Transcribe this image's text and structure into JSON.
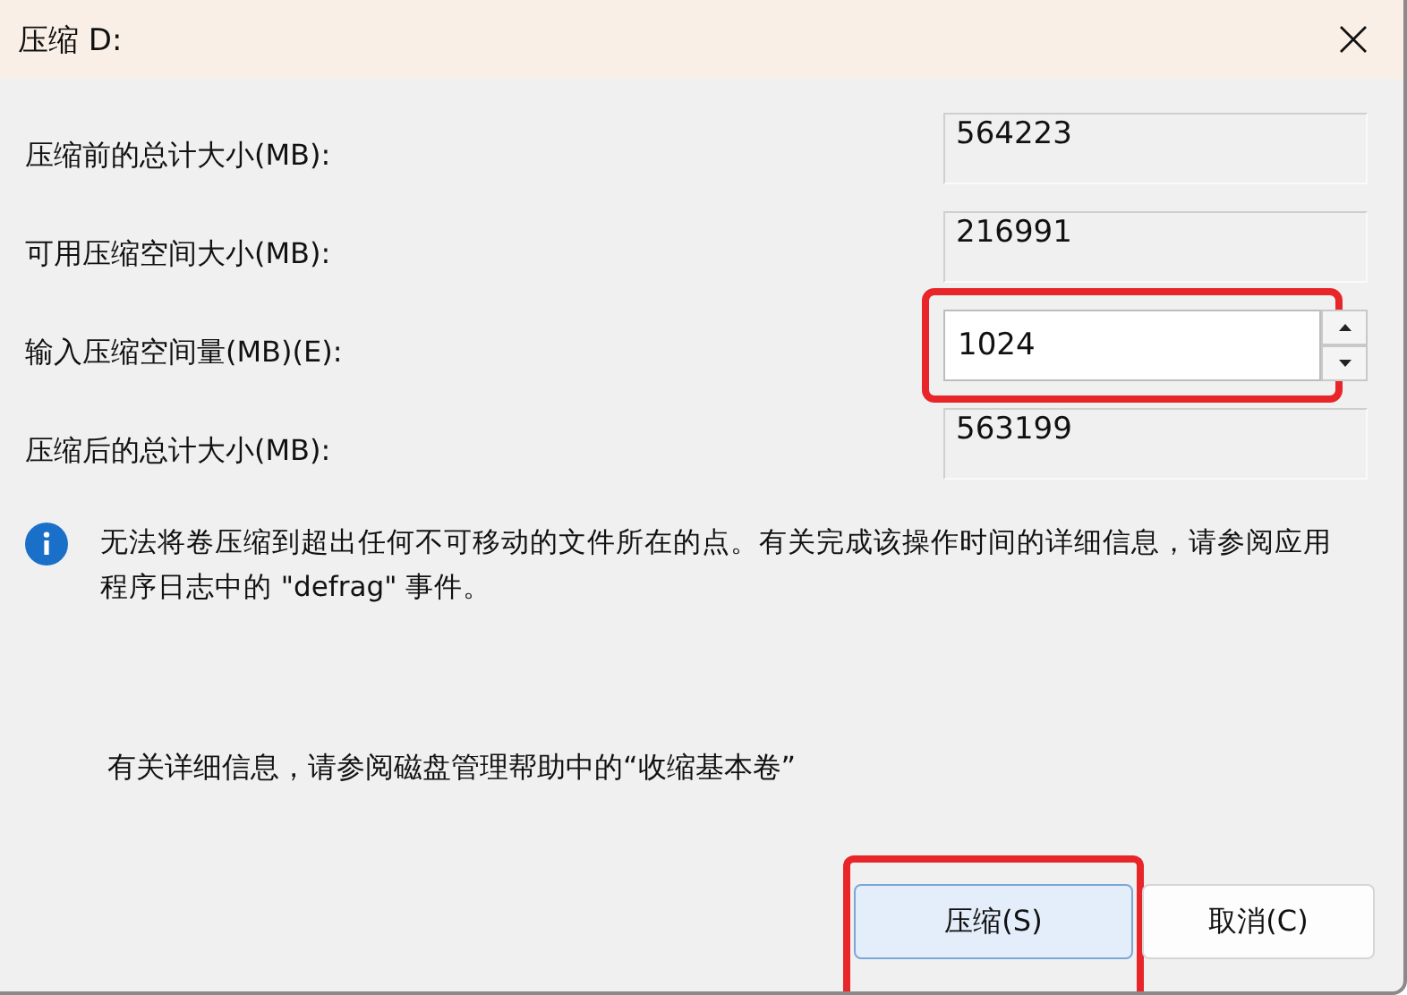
{
  "window": {
    "title": "压缩 D:"
  },
  "fields": [
    {
      "kind": "readonly",
      "label": "压缩前的总计大小(MB):",
      "value": "564223",
      "highlighted": false
    },
    {
      "kind": "readonly",
      "label": "可用压缩空间大小(MB):",
      "value": "216991",
      "highlighted": false
    },
    {
      "kind": "spin",
      "label": "输入压缩空间量(MB)(E):",
      "value": "1024",
      "highlighted": true
    },
    {
      "kind": "readonly",
      "label": "压缩后的总计大小(MB):",
      "value": "563199",
      "highlighted": false
    }
  ],
  "info": {
    "text": "无法将卷压缩到超出任何不可移动的文件所在的点。有关完成该操作时间的详细信息，请参阅应用程序日志中的 \"defrag\" 事件。"
  },
  "help": "有关详细信息，请参阅磁盘管理帮助中的“收缩基本卷”",
  "buttons": [
    {
      "label": "压缩(S)",
      "kind": "primary",
      "highlighted": true
    },
    {
      "label": "取消(C)",
      "kind": "secondary",
      "highlighted": false
    }
  ]
}
